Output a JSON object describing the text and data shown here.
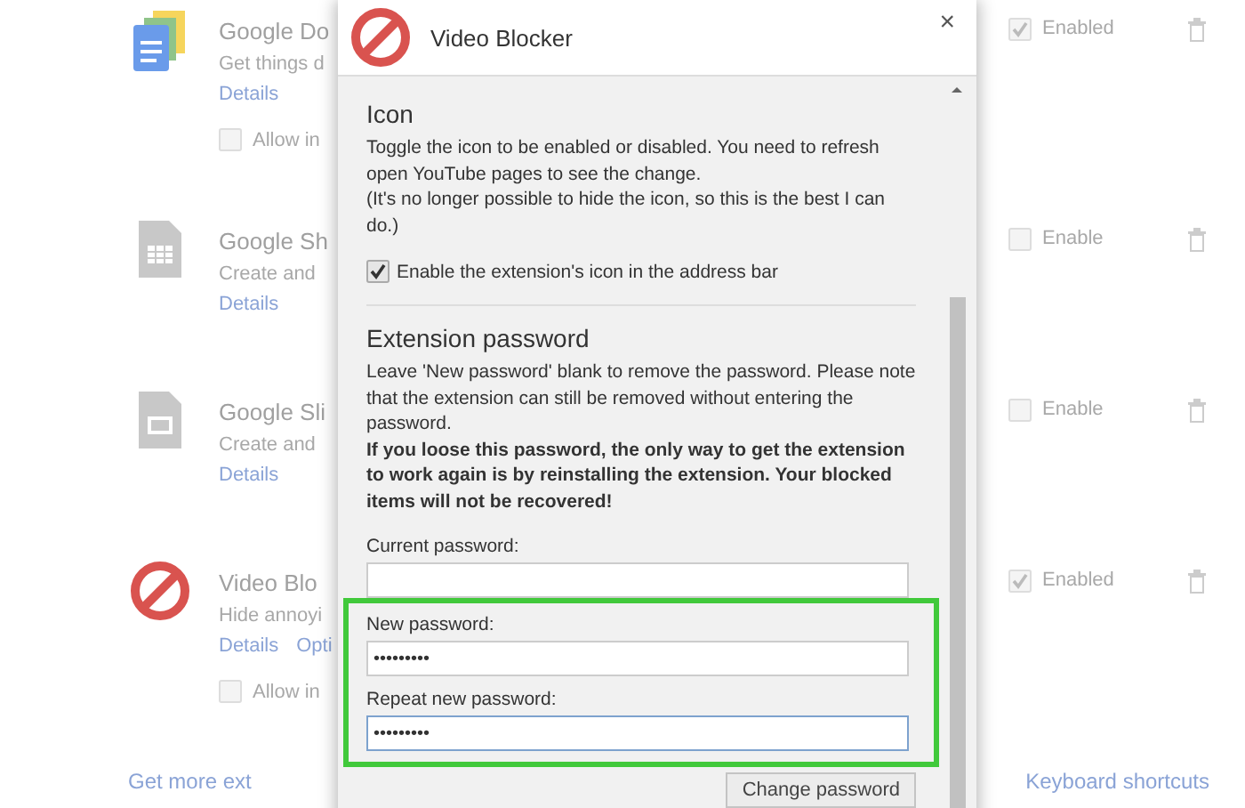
{
  "extensions": [
    {
      "kind": "docs",
      "name": "Google Do",
      "description": "Get things d",
      "links": [
        "Details"
      ],
      "incognito": {
        "label": "Allow in",
        "checked": false
      },
      "enable": {
        "label": "Enabled",
        "checked": true
      }
    },
    {
      "kind": "sheets",
      "name": "Google Sh",
      "description": "Create and",
      "links": [
        "Details"
      ],
      "enable": {
        "label": "Enable",
        "checked": false
      }
    },
    {
      "kind": "slides",
      "name": "Google Sli",
      "description": "Create and",
      "links": [
        "Details"
      ],
      "enable": {
        "label": "Enable",
        "checked": false
      }
    },
    {
      "kind": "blocker",
      "name": "Video Blo",
      "description": "Hide annoyi",
      "links": [
        "Details",
        "Opti"
      ],
      "incognito": {
        "label": "Allow in",
        "checked": false
      },
      "enable": {
        "label": "Enabled",
        "checked": true
      }
    }
  ],
  "footer": {
    "more_link": "Get more ext",
    "shortcuts_link": "Keyboard shortcuts"
  },
  "dialog": {
    "title": "Video Blocker",
    "close": "×",
    "sections": [
      {
        "heading": "Icon",
        "paragraphs": [
          {
            "text": "Toggle the icon to be enabled or disabled. You need to refresh open YouTube pages to see the change.",
            "bold": false
          },
          {
            "text": "(It's no longer possible to hide the icon, so this is the best I can do.)",
            "bold": false
          }
        ],
        "checkbox": {
          "label": "Enable the extension's icon in the address bar",
          "checked": true
        }
      },
      {
        "heading": "Extension password",
        "paragraphs": [
          {
            "text": "Leave 'New password' blank to remove the password. Please note that the extension can still be removed without entering the password.",
            "bold": false
          },
          {
            "text": "If you loose this password, the only way to get the extension to work again is by reinstalling the extension. Your blocked items will not be recovered!",
            "bold": true
          }
        ],
        "fields": [
          {
            "label": "Current password:",
            "highlighted": false,
            "focused": false
          },
          {
            "label": "New password:",
            "value": "•••••••••",
            "highlighted": true,
            "focused": false
          },
          {
            "label": "Repeat new password:",
            "value": "•••••••••",
            "highlighted": true,
            "focused": true
          }
        ],
        "button": "Change password"
      }
    ]
  }
}
